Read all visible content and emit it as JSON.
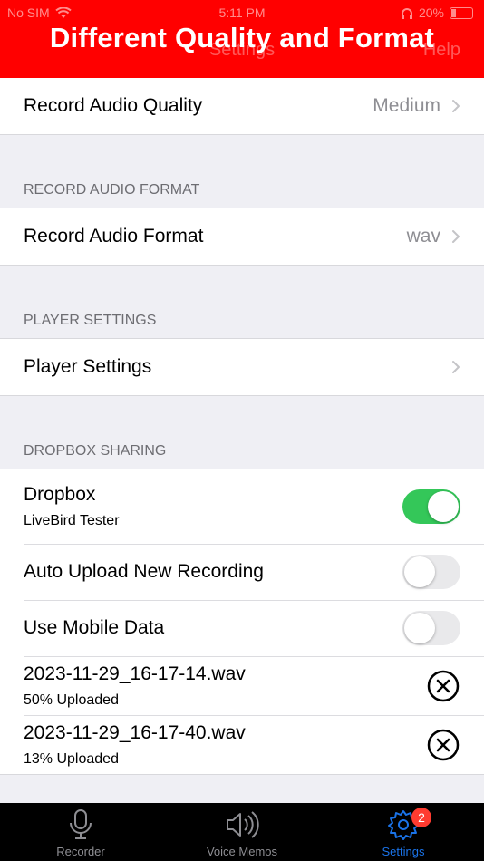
{
  "status_bar": {
    "carrier": "No SIM",
    "time": "5:11 PM",
    "battery": "20%"
  },
  "banner": {
    "title": "Different Quality and Format"
  },
  "navbar": {
    "title": "Settings",
    "help": "Help"
  },
  "quality": {
    "label": "Record Audio Quality",
    "value": "Medium"
  },
  "format_section": {
    "header": "RECORD AUDIO FORMAT",
    "label": "Record Audio Format",
    "value": "wav"
  },
  "player_section": {
    "header": "PLAYER SETTINGS",
    "label": "Player Settings"
  },
  "dropbox_section": {
    "header": "DROPBOX SHARING",
    "dropbox": {
      "label": "Dropbox",
      "account": "LiveBird Tester",
      "on": true
    },
    "auto_upload": {
      "label": "Auto Upload New Recording",
      "on": false
    },
    "mobile_data": {
      "label": "Use Mobile Data",
      "on": false
    },
    "uploads": [
      {
        "file": "2023-11-29_16-17-14.wav",
        "status": "50% Uploaded"
      },
      {
        "file": "2023-11-29_16-17-40.wav",
        "status": "13% Uploaded"
      }
    ]
  },
  "tabs": [
    {
      "label": "Recorder",
      "icon": "microphone-icon"
    },
    {
      "label": "Voice Memos",
      "icon": "speaker-icon"
    },
    {
      "label": "Settings",
      "icon": "gear-icon",
      "badge": "2",
      "active": true
    }
  ],
  "colors": {
    "banner": "#ff0000",
    "toggle_on": "#34c759",
    "tab_active": "#1a73e8",
    "badge": "#ff3b30"
  }
}
